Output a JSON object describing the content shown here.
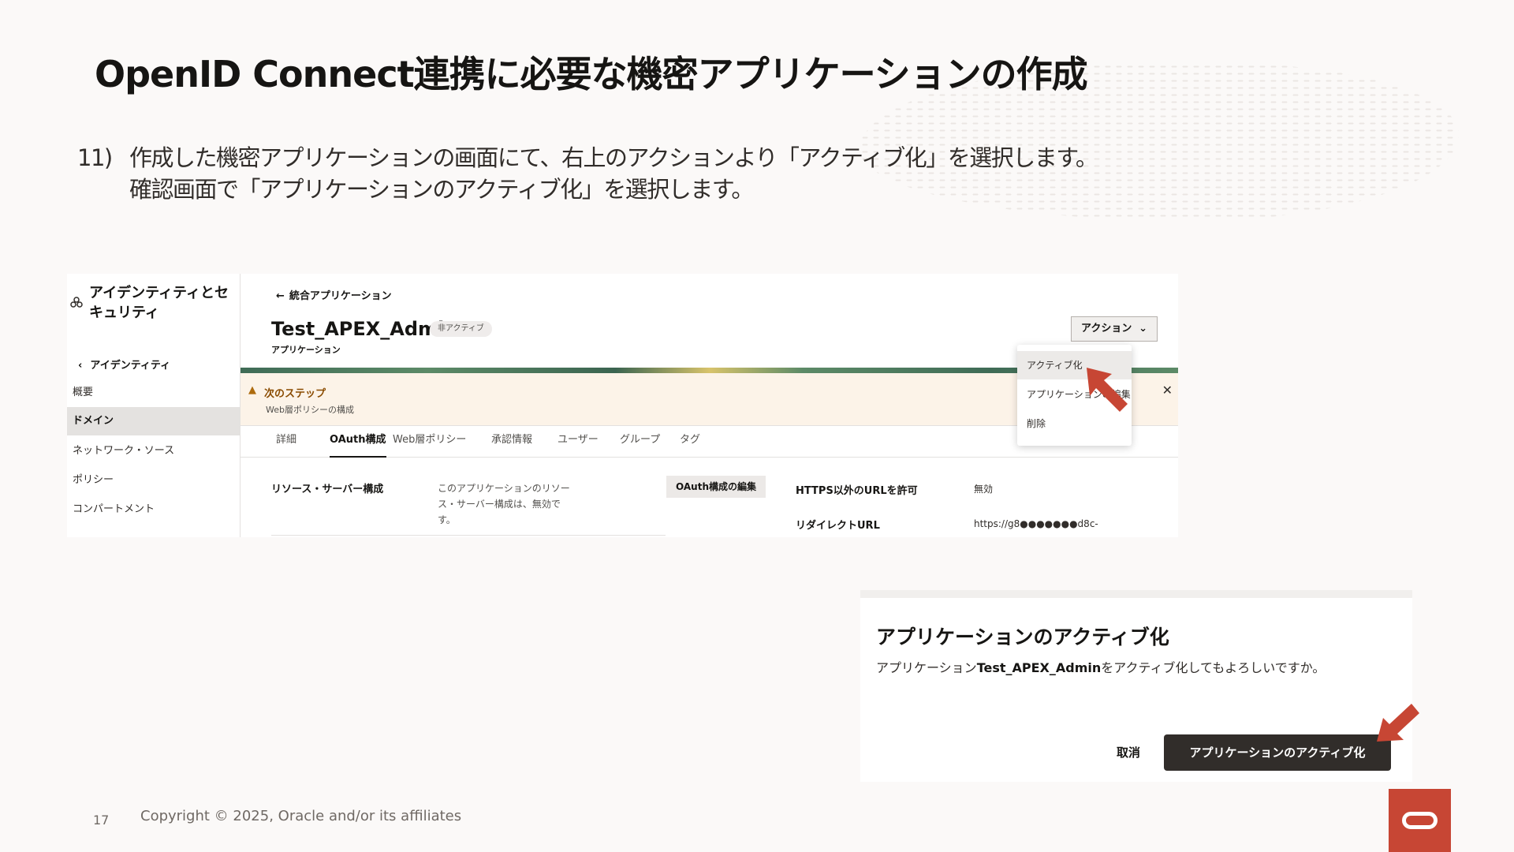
{
  "slide": {
    "title": "OpenID Connect連携に必要な機密アプリケーションの作成",
    "step_number": "11)",
    "step_line1": "作成した機密アプリケーションの画面にて、右上のアクションより「アクティブ化」を選択します。",
    "step_line2": "確認画面で「アプリケーションのアクティブ化」を選択します。",
    "page_number": "17",
    "copyright": "Copyright © 2025, Oracle and/or its affiliates"
  },
  "sidebar": {
    "title": "アイデンティティとセキュリティ",
    "back_label": "アイデンティティ",
    "items": [
      {
        "label": "概要"
      },
      {
        "label": "ドメイン",
        "active": true
      },
      {
        "label": "ネットワーク・ソース"
      },
      {
        "label": "ポリシー"
      },
      {
        "label": "コンパートメント"
      }
    ]
  },
  "app": {
    "breadcrumb": "統合アプリケーション",
    "name": "Test_APEX_Admin",
    "status_badge": "非アクティブ",
    "type": "アプリケーション",
    "action_button": "アクション"
  },
  "notice": {
    "title": "次のステップ",
    "desc": "Web層ポリシーの構成"
  },
  "tabs": [
    "詳細",
    "OAuth構成",
    "Web層ポリシー",
    "承認情報",
    "ユーザー",
    "グループ",
    "タグ"
  ],
  "active_tab": "OAuth構成",
  "oauth": {
    "section_label": "リソース・サーバー構成",
    "section_desc": "このアプリケーションのリソース・サーバー構成は、無効です。",
    "edit_button": "OAuth構成の編集",
    "fields": [
      {
        "label": "HTTPS以外のURLを許可",
        "value": "無効"
      },
      {
        "label": "リダイレクトURL",
        "value": "https://g8●●●●●●●d8c-"
      }
    ]
  },
  "dropdown": {
    "items": [
      "アクティブ化",
      "アプリケーションの編集",
      "削除"
    ],
    "highlighted": "アクティブ化"
  },
  "dialog": {
    "title": "アプリケーションのアクティブ化",
    "msg_prefix": "アプリケーション",
    "msg_app": "Test_APEX_Admin",
    "msg_suffix": "をアクティブ化してもよろしいですか。",
    "cancel": "取消",
    "confirm": "アプリケーションのアクティブ化"
  },
  "colors": {
    "arrow": "#c74634",
    "oracle_red": "#c74634"
  },
  "icons": {
    "sidebar": "identity-icon",
    "back": "chevron-left-icon",
    "breadcrumb": "arrow-left-icon",
    "warning": "warning-icon",
    "close": "close-icon",
    "dropdown_chevron": "chevron-down-icon",
    "logo": "oracle-logo-icon",
    "pointer": "red-arrow-icon"
  }
}
